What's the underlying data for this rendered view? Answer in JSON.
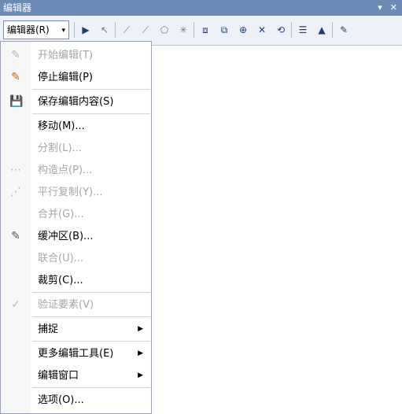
{
  "window": {
    "title": "编辑器",
    "controls": [
      "▾",
      "✕"
    ]
  },
  "toolbar": {
    "editor_label": "编辑器(R)",
    "editor_arrow": "▾",
    "tools": [
      {
        "icon": "▶"
      },
      {
        "icon": "↖"
      },
      {
        "icon": "⟋"
      },
      {
        "icon": "⟋"
      },
      {
        "icon": "⬠"
      },
      {
        "icon": "✳"
      },
      {
        "icon": "⧈"
      },
      {
        "icon": "⧉"
      },
      {
        "icon": "⊕"
      },
      {
        "icon": "✕"
      },
      {
        "icon": "⟲"
      },
      {
        "icon": "☰"
      },
      {
        "icon": "▲"
      },
      {
        "icon": "✎"
      }
    ]
  },
  "menu": {
    "items": [
      {
        "label": "开始编辑(T)",
        "icon": "✎",
        "enabled": false
      },
      {
        "label": "停止编辑(P)",
        "icon": "✎",
        "enabled": true
      },
      {
        "label": "保存编辑内容(S)",
        "icon": "💾",
        "enabled": true
      },
      {
        "label": "移动(M)...",
        "icon": "",
        "enabled": true
      },
      {
        "label": "分割(L)...",
        "icon": "",
        "enabled": false
      },
      {
        "label": "构造点(P)...",
        "icon": "⋯",
        "enabled": false
      },
      {
        "label": "平行复制(Y)...",
        "icon": "⋰",
        "enabled": false
      },
      {
        "label": "合并(G)...",
        "icon": "",
        "enabled": false
      },
      {
        "label": "缓冲区(B)...",
        "icon": "✎",
        "enabled": true
      },
      {
        "label": "联合(U)...",
        "icon": "",
        "enabled": false
      },
      {
        "label": "裁剪(C)...",
        "icon": "",
        "enabled": true
      },
      {
        "label": "验证要素(V)",
        "icon": "✓",
        "enabled": false
      },
      {
        "label": "捕捉",
        "icon": "",
        "enabled": true,
        "submenu": "▶"
      },
      {
        "label": "更多编辑工具(E)",
        "icon": "",
        "enabled": true,
        "submenu": "▶"
      },
      {
        "label": "编辑窗口",
        "icon": "",
        "enabled": true,
        "submenu": "▶"
      },
      {
        "label": "选项(O)...",
        "icon": "",
        "enabled": true
      }
    ]
  }
}
